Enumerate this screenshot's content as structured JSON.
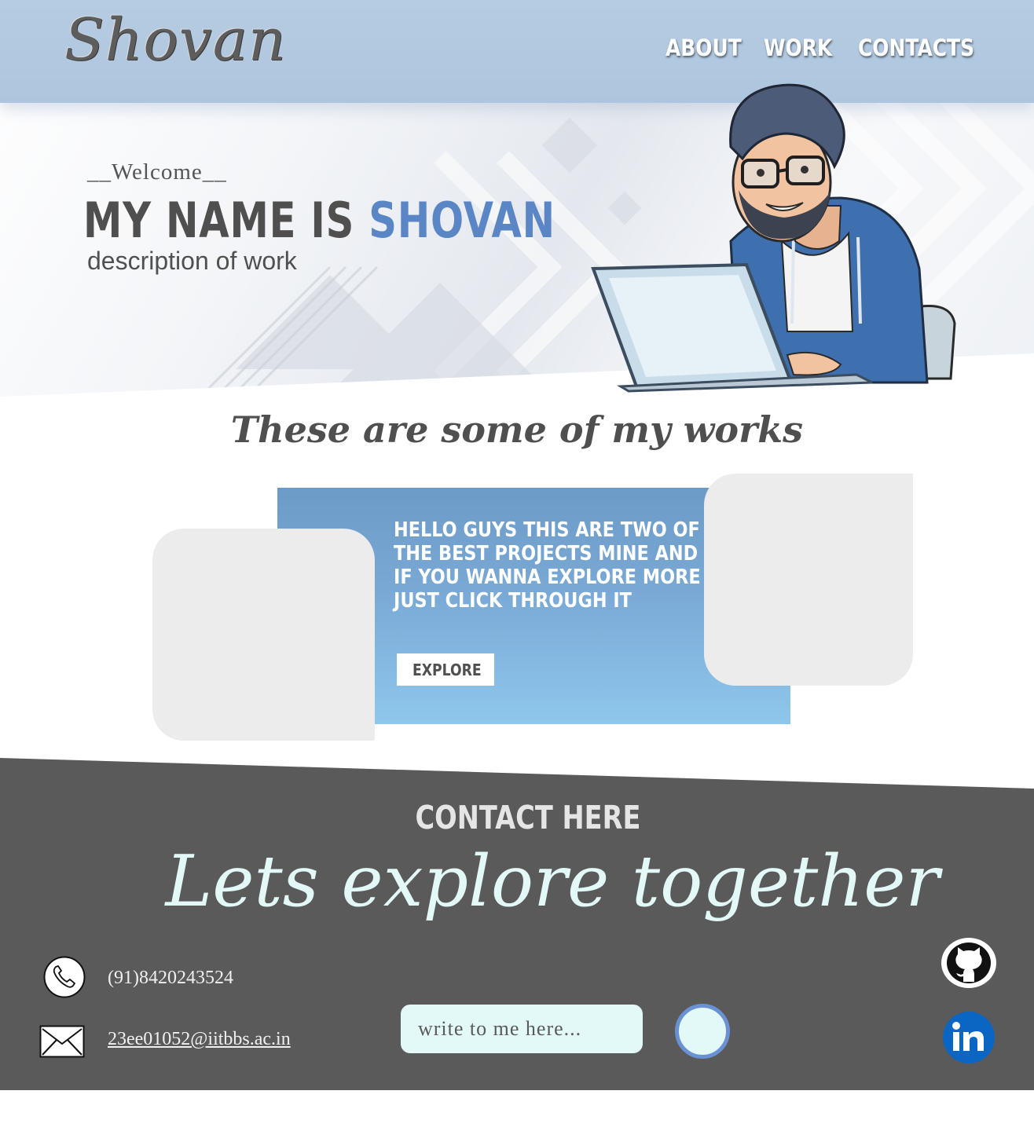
{
  "brand": {
    "logo_text": "Shovan"
  },
  "nav": {
    "items": [
      {
        "label": "ABOUT"
      },
      {
        "label": "WORK"
      },
      {
        "label": "CONTACTS"
      }
    ]
  },
  "hero": {
    "welcome": "__Welcome__",
    "headline_prefix": "MY NAME IS ",
    "headline_name": "SHOVAN",
    "description": "description of work",
    "illustration": "developer-with-laptop"
  },
  "works": {
    "title": "These are some of my works",
    "text": "hello guys this are two of the best projects mine and if you wanna explore more just click through it",
    "explore_label": "EXPLORE"
  },
  "contact": {
    "heading": "CONTACT HERE",
    "tagline": "Lets explore together",
    "phone": "(91)8420243524",
    "email": "23ee01052@iitbbs.ac.in",
    "message_placeholder": "write to me here...",
    "social": [
      {
        "icon": "github-icon"
      },
      {
        "icon": "linkedin-icon"
      }
    ]
  },
  "colors": {
    "nav_bg": "#b6cce2",
    "accent_blue": "#5b86c5",
    "panel_blue": "#7aa9d6",
    "contact_bg": "#5a5a5a",
    "mint": "#e2f9f8",
    "linkedin": "#0a66c2"
  }
}
